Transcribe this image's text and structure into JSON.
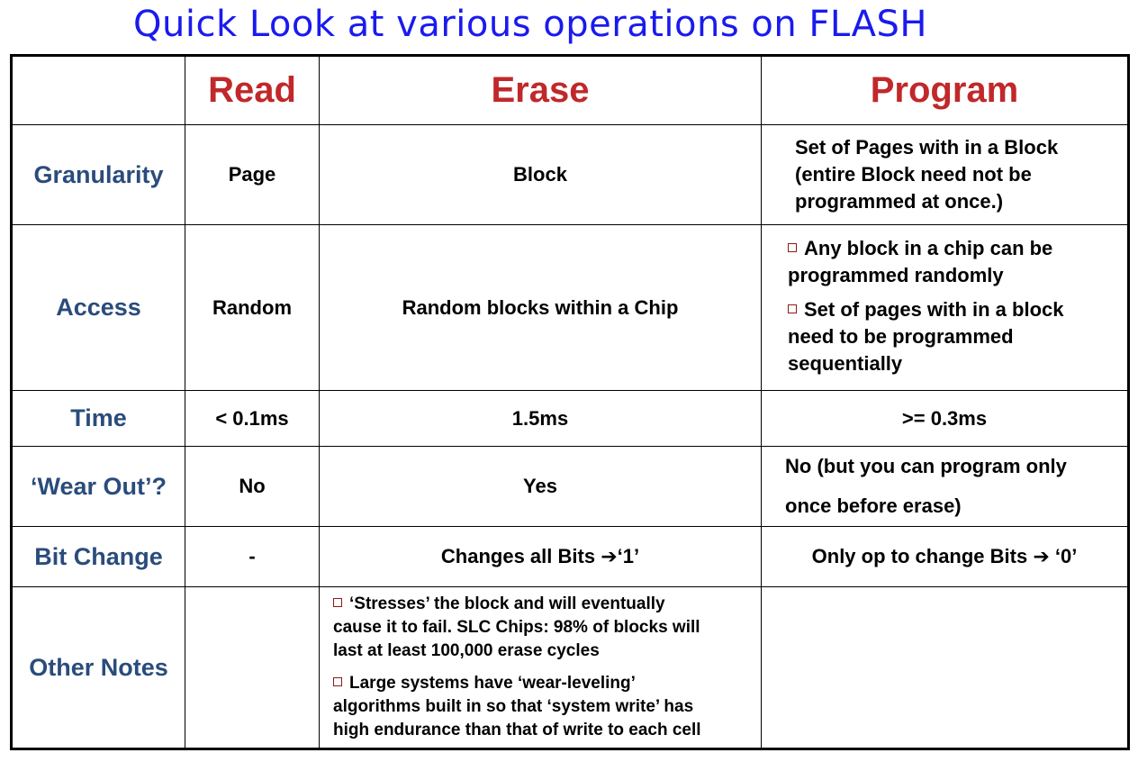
{
  "title": "Quick Look at various operations on FLASH",
  "columns": [
    "Read",
    "Erase",
    "Program"
  ],
  "rows": {
    "granularity": {
      "label": "Granularity",
      "read": "Page",
      "erase": "Block",
      "program_lines": [
        "Set of Pages with in a Block",
        "(entire Block need not be",
        "programmed at once.)"
      ]
    },
    "access": {
      "label": "Access",
      "read": "Random",
      "erase": "Random blocks within a Chip",
      "program_bullets": [
        [
          "Any block in a chip can be",
          "programmed randomly"
        ],
        [
          "Set of pages with in a block",
          "need to be programmed",
          "sequentially"
        ]
      ]
    },
    "time": {
      "label": "Time",
      "read": "< 0.1ms",
      "erase": "1.5ms",
      "program": ">= 0.3ms"
    },
    "wear_out": {
      "label": "‘Wear Out’?",
      "read": "No",
      "erase": "Yes",
      "program_lines": [
        "No (but you can program only",
        "once before erase)"
      ]
    },
    "bit_change": {
      "label": "Bit Change",
      "read": "-",
      "erase_text": "Changes all Bits ",
      "erase_arrow": "➔",
      "erase_value": "‘1’",
      "program_text": "Only op  to change Bits ",
      "program_arrow": "➔",
      "program_value": " ‘0’"
    },
    "other_notes": {
      "label": "Other Notes",
      "read": "",
      "erase_bullets": [
        [
          "‘Stresses’ the block and will eventually",
          "cause it to fail. SLC Chips: 98% of blocks will",
          "last at least 100,000 erase cycles"
        ],
        [
          "Large systems have ‘wear-leveling’",
          "algorithms built in so that ‘system write’ has",
          "high endurance than that of write to each cell"
        ]
      ],
      "program": ""
    }
  }
}
